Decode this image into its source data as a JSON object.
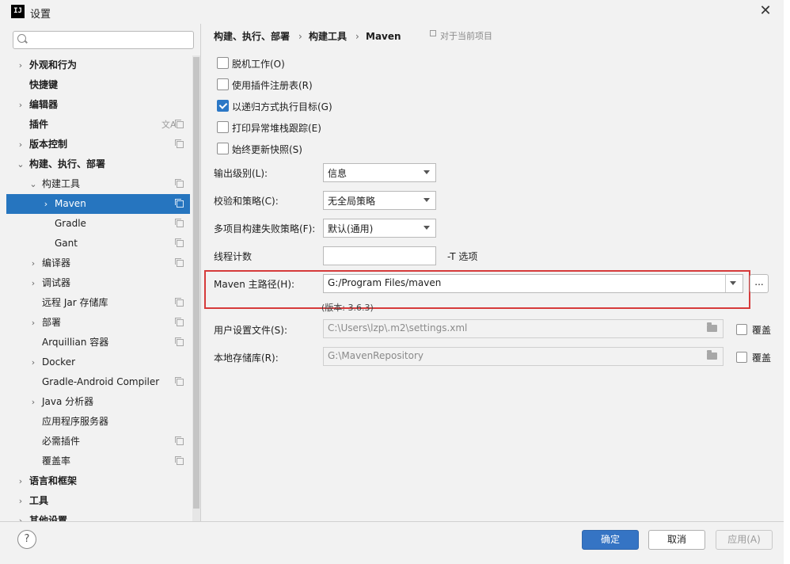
{
  "window": {
    "app_icon": "IJ",
    "title": "设置",
    "close_glyph": "✕"
  },
  "sidebar": {
    "search_placeholder": "",
    "items": [
      {
        "label": "外观和行为"
      },
      {
        "label": "快捷键"
      },
      {
        "label": "编辑器"
      },
      {
        "label": "插件"
      },
      {
        "label": "版本控制"
      },
      {
        "label": "构建、执行、部署"
      },
      {
        "label": "构建工具"
      },
      {
        "label": "Maven"
      },
      {
        "label": "Gradle"
      },
      {
        "label": "Gant"
      },
      {
        "label": "编译器"
      },
      {
        "label": "调试器"
      },
      {
        "label": "远程 Jar 存储库"
      },
      {
        "label": "部署"
      },
      {
        "label": "Arquillian 容器"
      },
      {
        "label": "Docker"
      },
      {
        "label": "Gradle-Android Compiler"
      },
      {
        "label": "Java 分析器"
      },
      {
        "label": "应用程序服务器"
      },
      {
        "label": "必需插件"
      },
      {
        "label": "覆盖率"
      },
      {
        "label": "语言和框架"
      },
      {
        "label": "工具"
      },
      {
        "label": "其他设置"
      }
    ]
  },
  "breadcrumb": {
    "items": [
      "构建、执行、部署",
      "构建工具",
      "Maven"
    ],
    "separator": "›",
    "note": "对于当前项目"
  },
  "checkboxes": [
    {
      "label": "脱机工作(O)",
      "checked": false
    },
    {
      "label": "使用插件注册表(R)",
      "checked": false
    },
    {
      "label": "以递归方式执行目标(G)",
      "checked": true
    },
    {
      "label": "打印异常堆栈跟踪(E)",
      "checked": false
    },
    {
      "label": "始终更新快照(S)",
      "checked": false
    }
  ],
  "fields": {
    "output_level": {
      "label": "输出级别(L):",
      "value": "信息"
    },
    "checksum_policy": {
      "label": "校验和策略(C):",
      "value": "无全局策略"
    },
    "multiproject_fail": {
      "label": "多项目构建失败策略(F):",
      "value": "默认(通用)"
    },
    "thread_count": {
      "label": "线程计数",
      "value": "",
      "suffix": "-T 选项"
    },
    "maven_home": {
      "label": "Maven 主路径(H):",
      "value": "G:/Program Files/maven",
      "browse": "...",
      "version": "(版本: 3.6.3)"
    },
    "user_settings": {
      "label": "用户设置文件(S):",
      "value": "C:\\Users\\lzp\\.m2\\settings.xml",
      "override": "覆盖"
    },
    "local_repo": {
      "label": "本地存储库(R):",
      "value": "G:\\MavenRepository",
      "override": "覆盖"
    }
  },
  "footer": {
    "help": "?",
    "ok": "确定",
    "cancel": "取消",
    "apply": "应用(A)"
  },
  "colors": {
    "selection": "#2675bf",
    "primary_button": "#3574c4",
    "highlight_box": "#d63b3b"
  }
}
